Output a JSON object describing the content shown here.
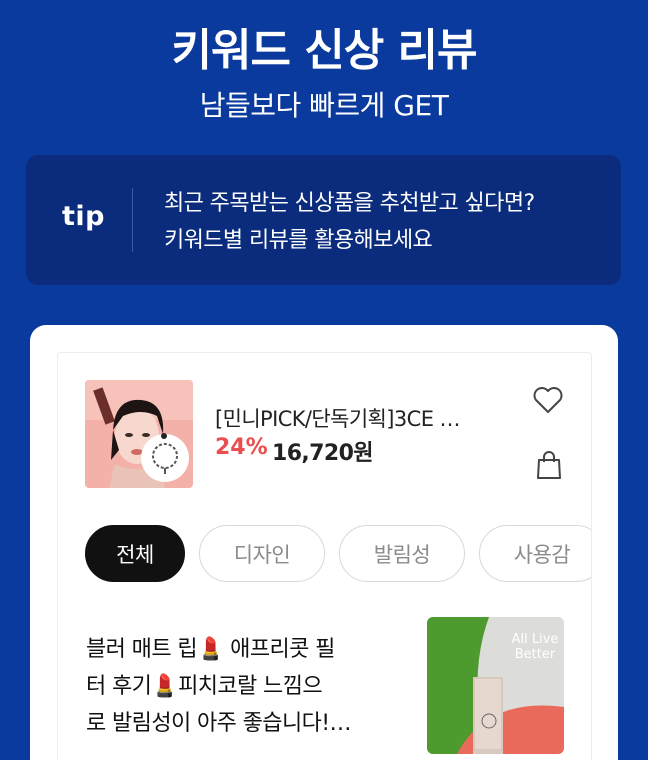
{
  "header": {
    "title": "키워드 신상 리뷰",
    "subtitle": "남들보다 빠르게 GET"
  },
  "tip": {
    "label": "tip",
    "line1": "최근 주목받는 신상품을 추천받고 싶다면?",
    "line2": "키워드별 리뷰를 활용해보세요"
  },
  "product": {
    "name": "[민니PICK/단독기획]3CE …",
    "discount": "24%",
    "price": "16,720원"
  },
  "chips": [
    {
      "label": "전체",
      "active": true
    },
    {
      "label": "디자인",
      "active": false
    },
    {
      "label": "발림성",
      "active": false
    },
    {
      "label": "사용감",
      "active": false
    }
  ],
  "review": {
    "line1": "블러 매트 립💄 애프리콧 필",
    "line2": "터 후기💄피치코랄 느낌으",
    "line3": "로 발림성이 아주 좋습니다!…",
    "image_text_1": "All Live",
    "image_text_2": "Better"
  },
  "colors": {
    "background": "#0a3a9e",
    "tip_box": "#0b2c7c",
    "discount": "#ea4e4e",
    "active_chip": "#111111"
  },
  "icons": {
    "wishlist": "heart-icon",
    "cart": "shopping-bag-icon"
  }
}
